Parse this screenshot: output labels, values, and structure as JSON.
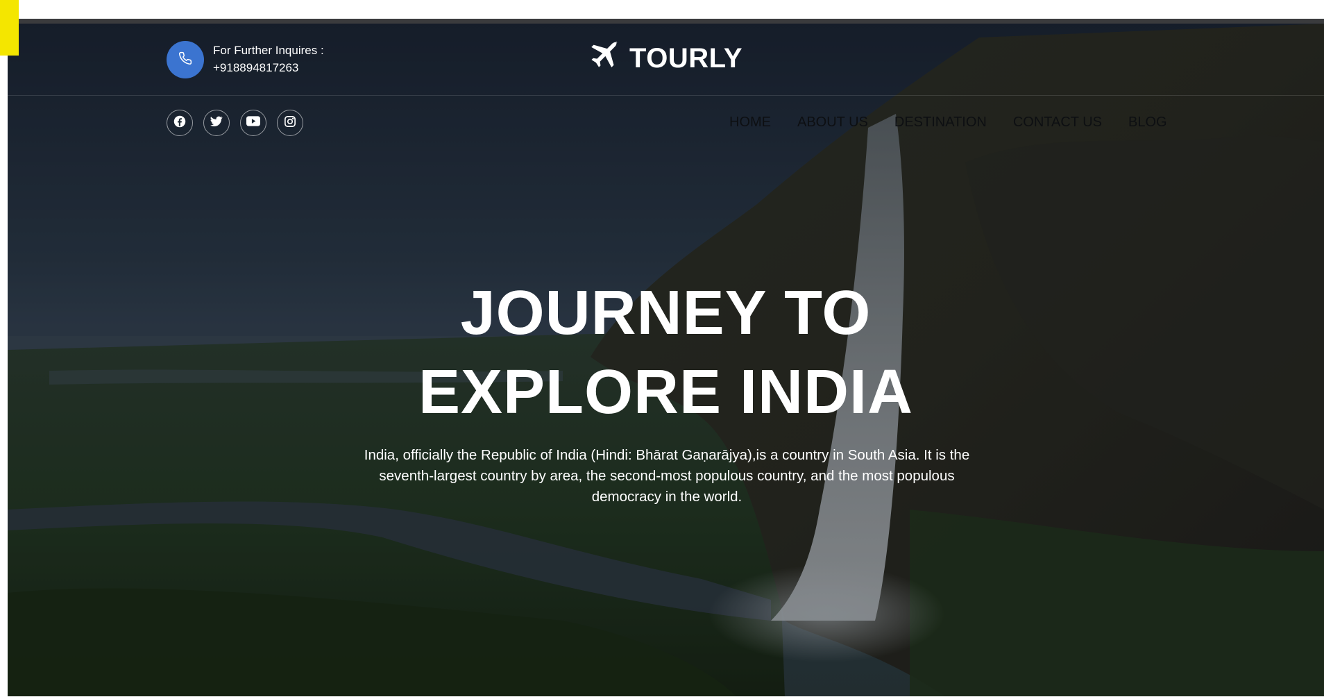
{
  "header": {
    "phone_label": "For Further Inquires :",
    "phone_number": "+918894817263",
    "logo_text": "TOURLY",
    "logo_icon": "airplane-icon",
    "phone_icon": "phone-icon"
  },
  "socials": [
    {
      "icon": "facebook-icon"
    },
    {
      "icon": "twitter-icon"
    },
    {
      "icon": "youtube-icon"
    },
    {
      "icon": "instagram-icon"
    }
  ],
  "nav": {
    "items": [
      "HOME",
      "ABOUT US",
      "DESTINATION",
      "CONTACT US",
      "BLOG"
    ]
  },
  "hero": {
    "title_line1": "JOURNEY TO",
    "title_line2": "EXPLORE INDIA",
    "description": "India, officially the Republic of India (Hindi: Bhārat Gaṇarājya),is a country in South Asia. It is the seventh-largest country by area, the second-most populous country, and the most populous democracy in the world."
  },
  "colors": {
    "accent": "#3b74d0",
    "marker": "#f4e600",
    "text_light": "#ffffff",
    "nav_text": "#0d0f12"
  }
}
